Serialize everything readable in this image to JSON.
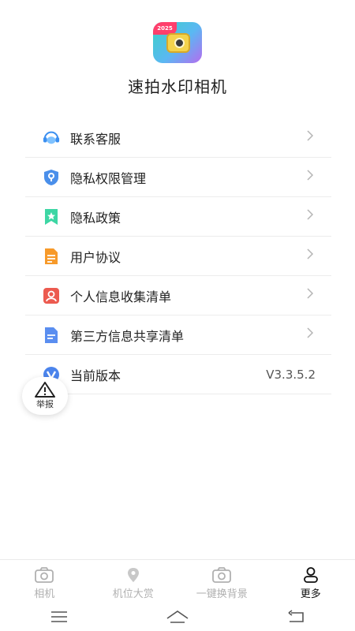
{
  "app": {
    "title": "速拍水印相机",
    "icon_badge": "2025"
  },
  "menu": {
    "items": [
      {
        "label": "联系客服",
        "icon": "customer-service-icon",
        "color": "#3b8ff0"
      },
      {
        "label": "隐私权限管理",
        "icon": "privacy-shield-icon",
        "color": "#4a8fea"
      },
      {
        "label": "隐私政策",
        "icon": "bookmark-star-icon",
        "color": "#3dd6a4"
      },
      {
        "label": "用户协议",
        "icon": "document-icon",
        "color": "#f79a2a"
      },
      {
        "label": "个人信息收集清单",
        "icon": "person-icon",
        "color": "#ec5a4f"
      },
      {
        "label": "第三方信息共享清单",
        "icon": "share-doc-icon",
        "color": "#5a8ef0"
      },
      {
        "label": "当前版本",
        "icon": "version-icon",
        "color": "#4b84ec",
        "value": "V3.3.5.2"
      }
    ]
  },
  "report": {
    "label": "举报"
  },
  "tabbar": {
    "tabs": [
      {
        "label": "相机",
        "icon": "camera-icon",
        "active": false
      },
      {
        "label": "机位大赏",
        "icon": "location-pin-icon",
        "active": false
      },
      {
        "label": "一键换背景",
        "icon": "camera-swap-icon",
        "active": false
      },
      {
        "label": "更多",
        "icon": "user-icon",
        "active": true
      }
    ]
  },
  "system_nav": {
    "buttons": [
      "menu-icon",
      "home-icon",
      "back-icon"
    ]
  }
}
